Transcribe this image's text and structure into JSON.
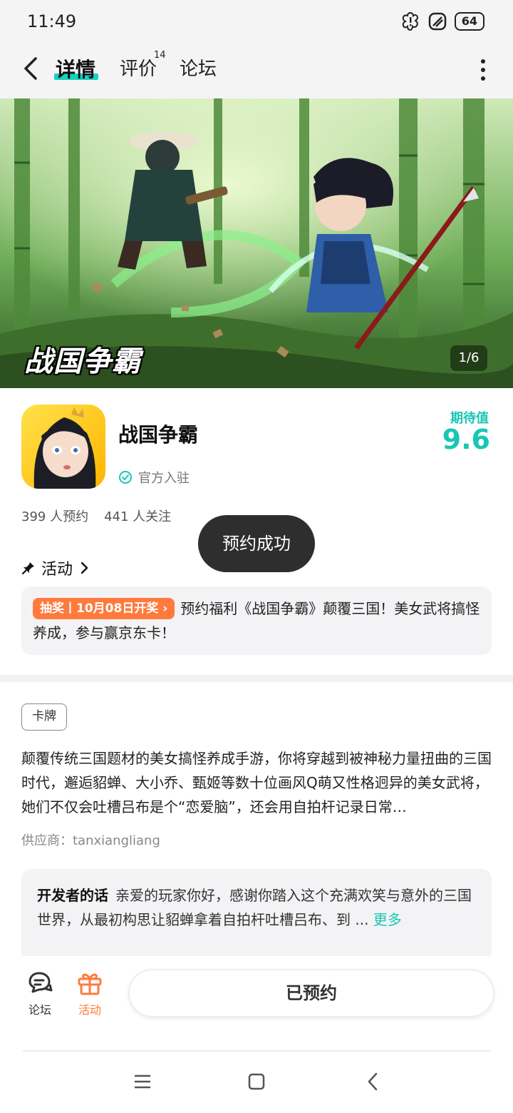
{
  "status_bar": {
    "time": "11:49",
    "battery": "64"
  },
  "nav": {
    "tabs": [
      {
        "label": "详情"
      },
      {
        "label": "评价",
        "count": "14"
      },
      {
        "label": "论坛"
      }
    ]
  },
  "banner": {
    "logo_text": "战国争霸",
    "index": "1/6"
  },
  "game": {
    "title": "战国争霸",
    "official_label": "官方入驻",
    "score_label": "期待值",
    "score": "9.6",
    "reservations": "399 人预约",
    "followers": "441 人关注"
  },
  "toast": "预约成功",
  "activity": {
    "heading": "活动",
    "tag": "抽奖丨10月08日开奖",
    "text": "预约福利《战国争霸》颠覆三国！美女武将搞怪养成，参与赢京东卡！"
  },
  "details": {
    "genre": "卡牌",
    "description": "颠覆传统三国题材的美女搞怪养成手游，你将穿越到被神秘力量扭曲的三国时代，邂逅貂蝉、大小乔、甄姬等数十位画风Q萌又性格迥异的美女武将，她们不仅会吐槽吕布是个“恋爱脑”，还会用自拍杆记录日常…",
    "provider": "供应商：tanxiangliang"
  },
  "developer": {
    "label": "开发者的话",
    "text": "亲爱的玩家你好，感谢你踏入这个充满欢笑与意外的三国世界，从最初构思让貂蝉拿着自拍杆吐槽吕布、到 ...",
    "more": "更多"
  },
  "bottom_bar": {
    "forum_label": "论坛",
    "activity_label": "活动",
    "reserved_label": "已预约"
  },
  "colors": {
    "accent": "#17c7b6",
    "orange": "#ff7a3d",
    "toast_bg": "#2e2e2e"
  }
}
